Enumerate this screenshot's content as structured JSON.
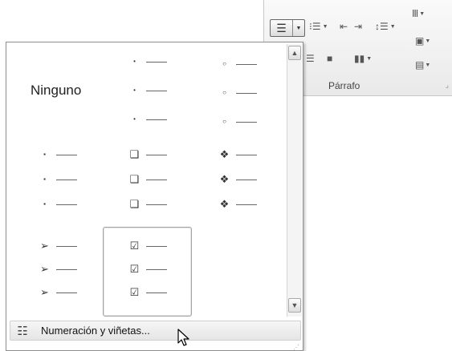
{
  "ribbon": {
    "group_label": "Párrafo",
    "buttons": [
      {
        "name": "bullets",
        "icon": "bullet-list-icon",
        "state": "pressed"
      },
      {
        "name": "numbering",
        "icon": "numbered-list-icon"
      },
      {
        "name": "decrease-indent",
        "icon": "decrease-indent-icon"
      },
      {
        "name": "increase-indent",
        "icon": "increase-indent-icon"
      },
      {
        "name": "line-spacing",
        "icon": "line-spacing-icon"
      },
      {
        "name": "sort",
        "icon": "sort-icon"
      },
      {
        "name": "align-right",
        "icon": "align-right-icon"
      },
      {
        "name": "justify",
        "icon": "justify-icon"
      },
      {
        "name": "columns",
        "icon": "columns-icon"
      }
    ]
  },
  "gallery": {
    "none_label": "Ninguno",
    "styles": [
      {
        "name": "none"
      },
      {
        "name": "small-filled-dot",
        "glyph": "•"
      },
      {
        "name": "hollow-circle",
        "glyph": "○"
      },
      {
        "name": "filled-square",
        "glyph": "▪"
      },
      {
        "name": "hollow-square",
        "glyph": "❑"
      },
      {
        "name": "four-diamond",
        "glyph": "❖"
      },
      {
        "name": "arrowhead",
        "glyph": "➢"
      },
      {
        "name": "check-box",
        "glyph": "☑",
        "selected": true
      }
    ],
    "footer_label": "Numeración y viñetas..."
  },
  "colors": {
    "border": "#8e8e8e",
    "footer_bg": "#ececec",
    "selected_border": "#a3a3a3"
  }
}
